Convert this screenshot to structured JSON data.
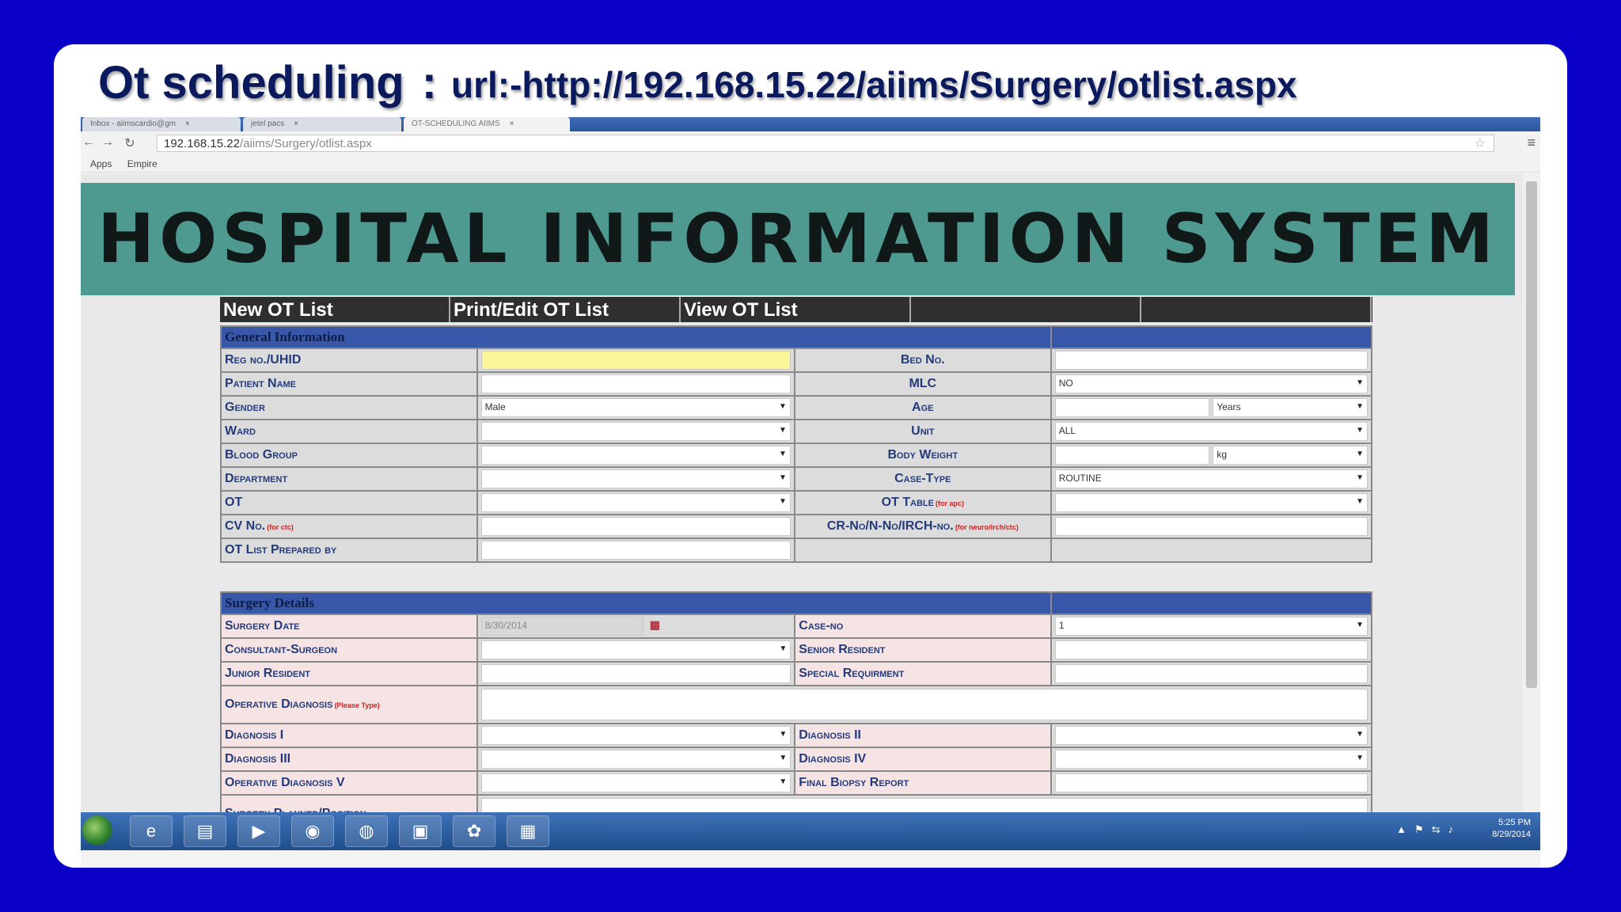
{
  "slide": {
    "title": "Ot scheduling",
    "separator": ":",
    "url_text": "url:-http://192.168.15.22/aiims/Surgery/otlist.aspx"
  },
  "browser": {
    "tabs": [
      "Inbox - aiimscardio@gm",
      "jetel pacs",
      "OT-SCHEDULING AIIMS"
    ],
    "tab_close": "×",
    "url_host": "192.168.15.22",
    "url_path": "/aiims/Surgery/otlist.aspx",
    "bookmarks": [
      "Apps",
      "Empire"
    ]
  },
  "banner": {
    "title": "HOSPITAL INFORMATION SYSTEM"
  },
  "menu": {
    "items": [
      "New OT List",
      "Print/Edit OT List",
      "View OT List",
      "",
      ""
    ]
  },
  "general": {
    "header": "General Information",
    "reg_no": "Reg no./UHID",
    "bed_no": "Bed No.",
    "patient_name": "Patient Name",
    "mlc": "MLC",
    "mlc_value": "NO",
    "gender": "Gender",
    "gender_value": "Male",
    "age": "Age",
    "age_unit": "Years",
    "ward": "Ward",
    "unit": "Unit",
    "unit_value": "ALL",
    "blood_group": "Blood Group",
    "body_weight": "Body Weight",
    "weight_unit": "kg",
    "department": "Department",
    "case_type": "Case-Type",
    "case_type_value": "ROUTINE",
    "ot": "OT",
    "ot_table": "OT Table",
    "ot_table_note": "(for apc)",
    "cv_no": "CV No.",
    "cv_no_note": "(for ctc)",
    "cr_no": "CR-No/N-No/IRCH-no.",
    "cr_no_note": "(for neuro/irch/ctc)",
    "prepared_by": "OT List Prepared by"
  },
  "surgery": {
    "header": "Surgery Details",
    "surgery_date": "Surgery Date",
    "surgery_date_value": "8/30/2014",
    "case_no": "Case-no",
    "case_no_value": "1",
    "consultant": "Consultant-Surgeon",
    "senior_resident": "Senior Resident",
    "junior_resident": "Junior Resident",
    "special_req": "Special Requirment",
    "operative_diag": "Operative Diagnosis",
    "operative_diag_note": "(Please Type)",
    "diag1": "Diagnosis I",
    "diag2": "Diagnosis II",
    "diag3": "Diagnosis III",
    "diag4": "Diagnosis IV",
    "diag5": "Operative Diagnosis V",
    "biopsy": "Final Biopsy Report",
    "planned_position": "Surgery Planned/Position"
  },
  "taskbar": {
    "time": "5:25 PM",
    "date": "8/29/2014"
  }
}
